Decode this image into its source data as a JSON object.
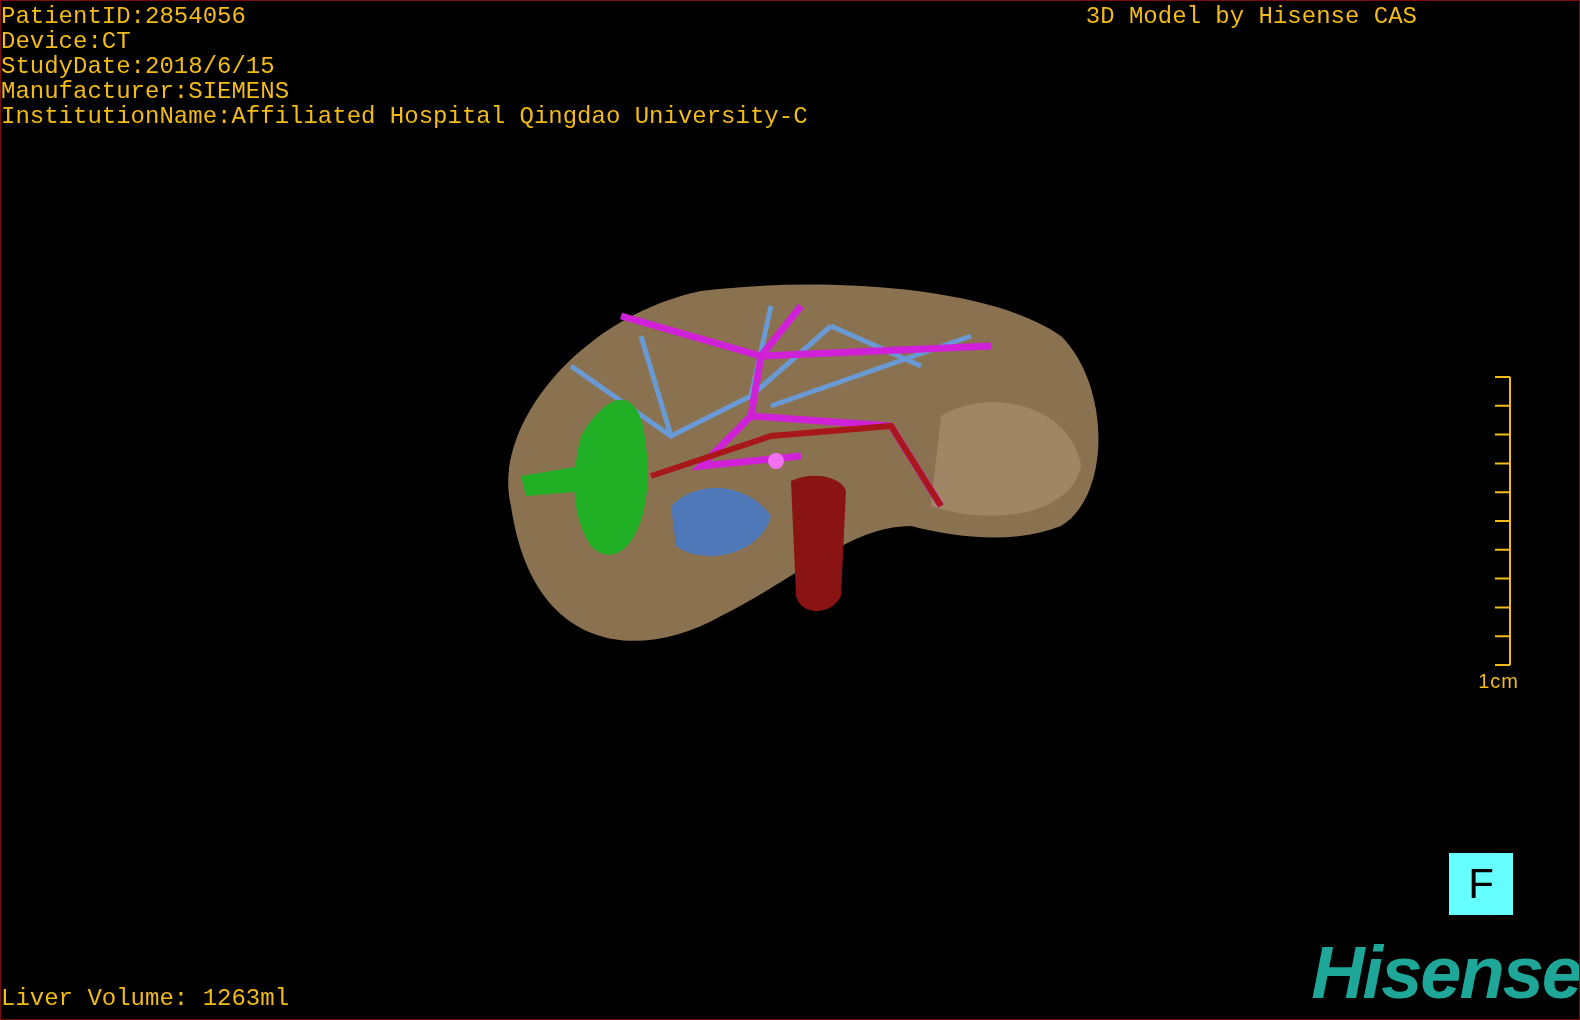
{
  "info_lines": [
    "PatientID:2854056",
    "Device:CT",
    "StudyDate:2018/6/15",
    "Manufacturer:SIEMENS",
    "InstitutionName:Affiliated Hospital Qingdao University-C"
  ],
  "title": "3D Model by Hisense CAS",
  "scale_bar": {
    "label": "1cm"
  },
  "liver_volume": "Liver Volume: 1263ml",
  "orientation_marker": "F",
  "logo": "Hisense"
}
